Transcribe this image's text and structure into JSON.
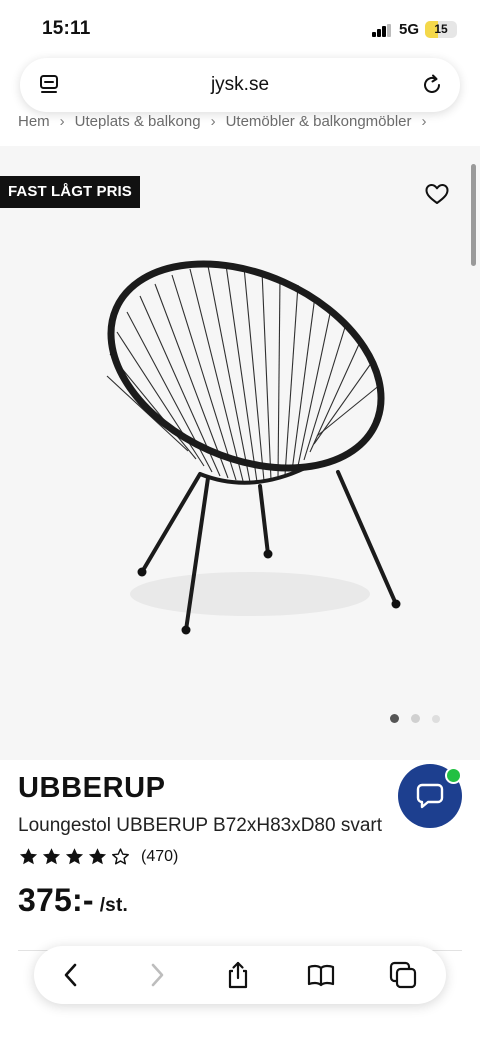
{
  "status": {
    "time": "15:11",
    "network": "5G",
    "battery": "15"
  },
  "browser": {
    "url": "jysk.se"
  },
  "breadcrumb": [
    "Hem",
    "Uteplats & balkong",
    "Utemöbler & balkongmöbler"
  ],
  "badge": "FAST LÅGT PRIS",
  "product": {
    "brand": "UBBERUP",
    "description": "Loungestol UBBERUP B72xH83xD80 svart",
    "rating": 4,
    "rating_max": 5,
    "review_count": "(470)",
    "price": "375:-",
    "unit": "/st."
  },
  "gallery": {
    "images": 3,
    "current": 1
  },
  "colors": {
    "chat_button": "#1d3f8f",
    "online": "#22c043",
    "badge_bg": "#111111",
    "battery": "#f4d84a"
  },
  "icons": [
    "tabs-icon",
    "reload-icon",
    "heart-icon",
    "chat-icon",
    "back-icon",
    "forward-icon",
    "share-icon",
    "bookmarks-icon",
    "tabs-overview-icon"
  ]
}
